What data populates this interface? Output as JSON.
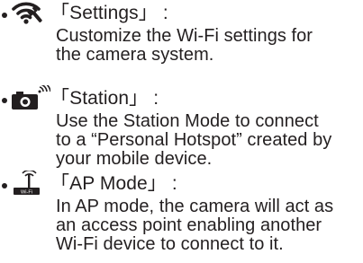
{
  "items": [
    {
      "icon": "wifi-settings-icon",
      "title": "「Settings」 :",
      "lines": [
        "Customize the Wi-Fi settings for",
        "the camera system."
      ]
    },
    {
      "icon": "camera-station-icon",
      "title": "「Station」 :",
      "lines": [
        "Use the Station Mode to connect",
        "to a “Personal Hotspot” created by",
        "your mobile device."
      ]
    },
    {
      "icon": "ap-mode-icon",
      "icon_label": "Wi-Fi",
      "title": "「AP Mode」 :",
      "lines": [
        "In AP mode, the camera will act as",
        "an access point enabling another",
        "Wi-Fi device to connect to it."
      ]
    }
  ]
}
